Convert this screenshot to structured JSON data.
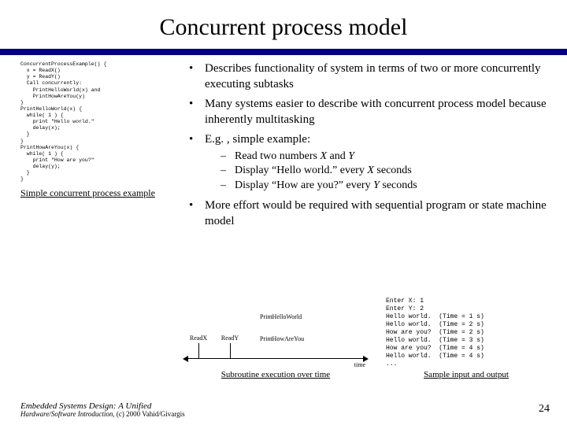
{
  "title": "Concurrent process model",
  "code": "ConcurrentProcessExample() {\n  x = ReadX()\n  y = ReadY()\n  Call concurrently:\n    PrintHelloWorld(x) and\n    PrintHowAreYou(y)\n}\nPrintHelloWorld(x) {\n  while( 1 ) {\n    print \"Hello world.\"\n    delay(x);\n  }\n}\nPrintHowAreYou(x) {\n  while( 1 ) {\n    print \"How are you?\"\n    delay(y);\n  }\n}",
  "left_caption": "Simple concurrent process example",
  "bullets": {
    "b1": "Describes functionality of system in terms of two or more concurrently executing subtasks",
    "b2": "Many systems easier to describe with concurrent process model because inherently multitasking",
    "b3": "E.g. , simple example:",
    "b3s1_a": "Read two numbers ",
    "b3s1_b": "X ",
    "b3s1_c": "and ",
    "b3s1_d": "Y",
    "b3s2_a": "Display “Hello world.” every ",
    "b3s2_b": "X ",
    "b3s2_c": "seconds",
    "b3s3_a": "Display “How are you?” every ",
    "b3s3_b": "Y ",
    "b3s3_c": "seconds",
    "b4": "More effort would be required with sequential program or state machine model"
  },
  "timeline": {
    "readx": "ReadX",
    "ready": "ReadY",
    "hello": "PrintHelloWorld",
    "how": "PrintHowAreYou",
    "time": "time",
    "caption": "Subroutine execution over time"
  },
  "output": "Enter X: 1\nEnter Y: 2\nHello world.  (Time = 1 s)\nHello world.  (Time = 2 s)\nHow are you?  (Time = 2 s)\nHello world.  (Time = 3 s)\nHow are you?  (Time = 4 s)\nHello world.  (Time = 4 s)\n...",
  "output_caption": "Sample input and output",
  "footer": {
    "line1": "Embedded Systems Design: A Unified",
    "line2": "Hardware/Software Introduction, ",
    "line2b": "(c) 2000 Vahid/Givargis"
  },
  "page": "24"
}
